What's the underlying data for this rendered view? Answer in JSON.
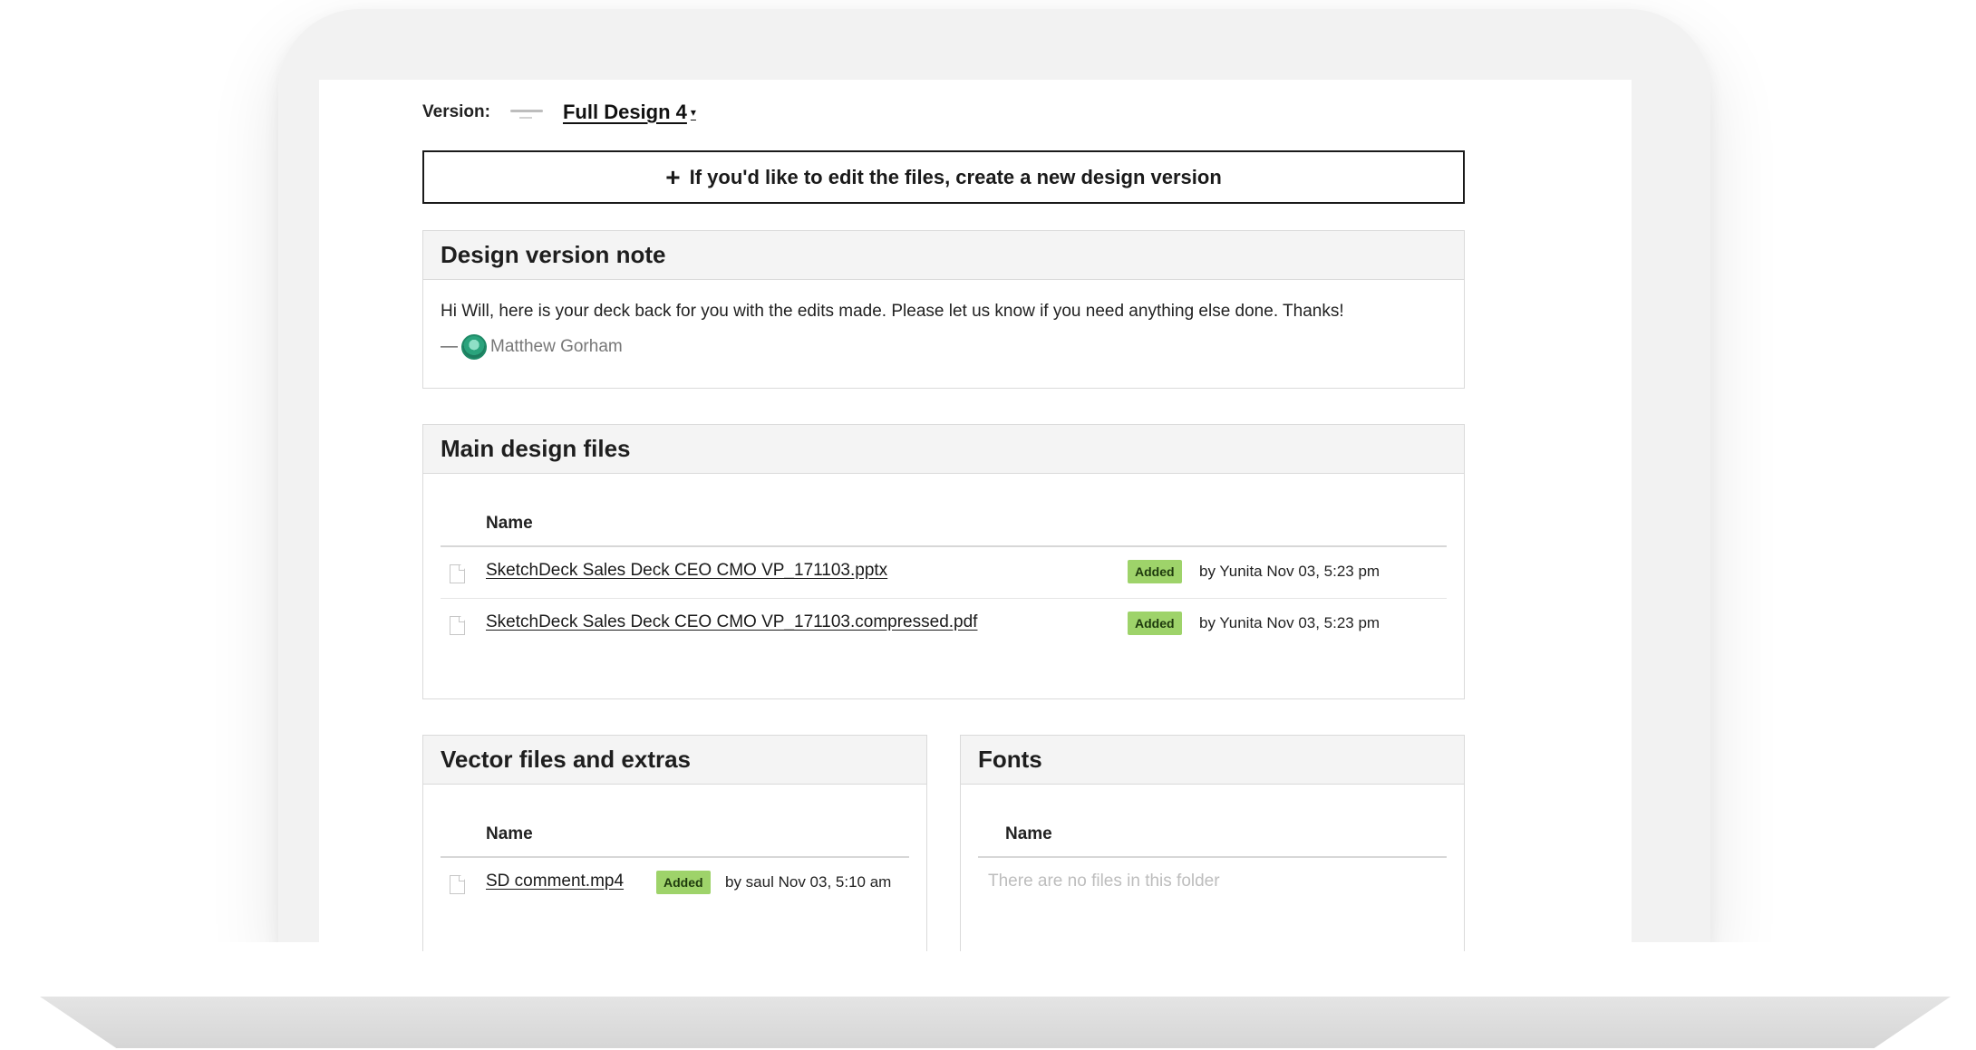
{
  "version": {
    "label": "Version:",
    "selected": "Full Design 4"
  },
  "create_button": {
    "label": "If you'd like to edit the files, create a new design version"
  },
  "note": {
    "title": "Design version note",
    "text": "Hi Will, here is your deck back for you with the edits made. Please let us know if you need anything else done. Thanks!",
    "dash": "—",
    "author": "Matthew Gorham"
  },
  "main_files": {
    "title": "Main design files",
    "column_name": "Name",
    "files": [
      {
        "name": "SketchDeck Sales Deck CEO CMO VP_171103.pptx",
        "status": "Added",
        "meta": "by Yunita Nov 03, 5:23 pm"
      },
      {
        "name": "SketchDeck Sales Deck CEO CMO VP_171103.compressed.pdf",
        "status": "Added",
        "meta": "by Yunita Nov 03, 5:23 pm"
      }
    ]
  },
  "vector_files": {
    "title": "Vector files and extras",
    "column_name": "Name",
    "files": [
      {
        "name": "SD comment.mp4",
        "status": "Added",
        "meta": "by saul Nov 03, 5:10 am"
      }
    ]
  },
  "fonts": {
    "title": "Fonts",
    "column_name": "Name",
    "empty_text": "There are no files in this folder"
  },
  "colors": {
    "badge": "#9ed36a",
    "bezel": "#f2f2f2"
  }
}
